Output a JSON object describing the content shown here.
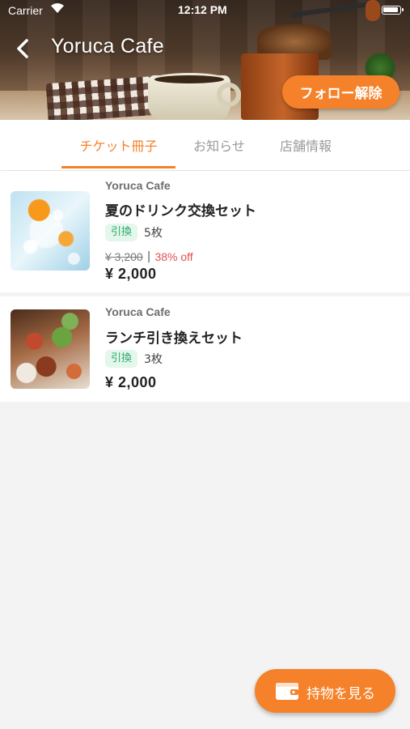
{
  "status_bar": {
    "carrier": "Carrier",
    "time": "12:12 PM"
  },
  "header": {
    "title": "Yoruca Cafe",
    "follow_button_label": "フォロー解除"
  },
  "tabs": [
    {
      "label": "チケット冊子",
      "active": true
    },
    {
      "label": "お知らせ",
      "active": false
    },
    {
      "label": "店舗情報",
      "active": false
    }
  ],
  "tickets": [
    {
      "shop": "Yoruca Cafe",
      "title": "夏のドリンク交換セット",
      "badge": "引換",
      "count": "5枚",
      "original_price": "¥ 3,200",
      "separator": "|",
      "discount": "38% off",
      "price": "¥ 2,000"
    },
    {
      "shop": "Yoruca Cafe",
      "title": "ランチ引き換えセット",
      "badge": "引換",
      "count": "3枚",
      "price": "¥ 2,000"
    }
  ],
  "fab": {
    "label": "持物を見る"
  },
  "colors": {
    "accent": "#f5822a",
    "badge_bg": "#e4f7ec",
    "badge_text": "#2da86b",
    "discount": "#e05050"
  }
}
